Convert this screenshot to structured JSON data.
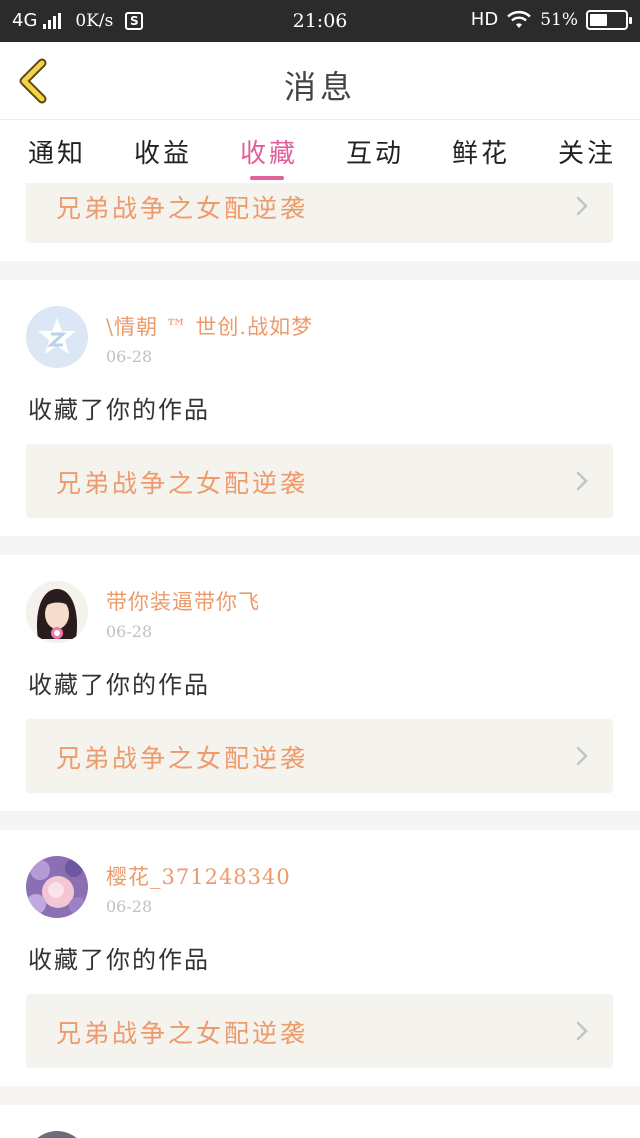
{
  "status_bar": {
    "network": "4G",
    "speed": "0K/s",
    "app_icon": "S",
    "time": "21:06",
    "hd": "HD",
    "battery": "51%",
    "battery_level": 0.51
  },
  "header": {
    "title": "消息",
    "back_icon": "chevron-left-icon"
  },
  "tabs": [
    {
      "label": "通知",
      "active": false
    },
    {
      "label": "收益",
      "active": false
    },
    {
      "label": "收藏",
      "active": true
    },
    {
      "label": "互动",
      "active": false
    },
    {
      "label": "鲜花",
      "active": false
    },
    {
      "label": "关注",
      "active": false
    }
  ],
  "colors": {
    "accent": "#e0609a",
    "username": "#ee9a6a",
    "card_bg": "#f4f3ee"
  },
  "partial_top_card": {
    "work_title": "兄弟战争之女配逆袭"
  },
  "items": [
    {
      "username": "\\情朝 ™ 世创.战如梦",
      "date": "06-28",
      "action": "收藏了你的作品",
      "work_title": "兄弟战争之女配逆袭",
      "avatar": "qq-default-avatar"
    },
    {
      "username": "带你装逼带你飞",
      "date": "06-28",
      "action": "收藏了你的作品",
      "work_title": "兄弟战争之女配逆袭",
      "avatar": "girl-avatar"
    },
    {
      "username": "樱花_371248340",
      "date": "06-28",
      "action": "收藏了你的作品",
      "work_title": "兄弟战争之女配逆袭",
      "avatar": "flower-avatar"
    }
  ]
}
